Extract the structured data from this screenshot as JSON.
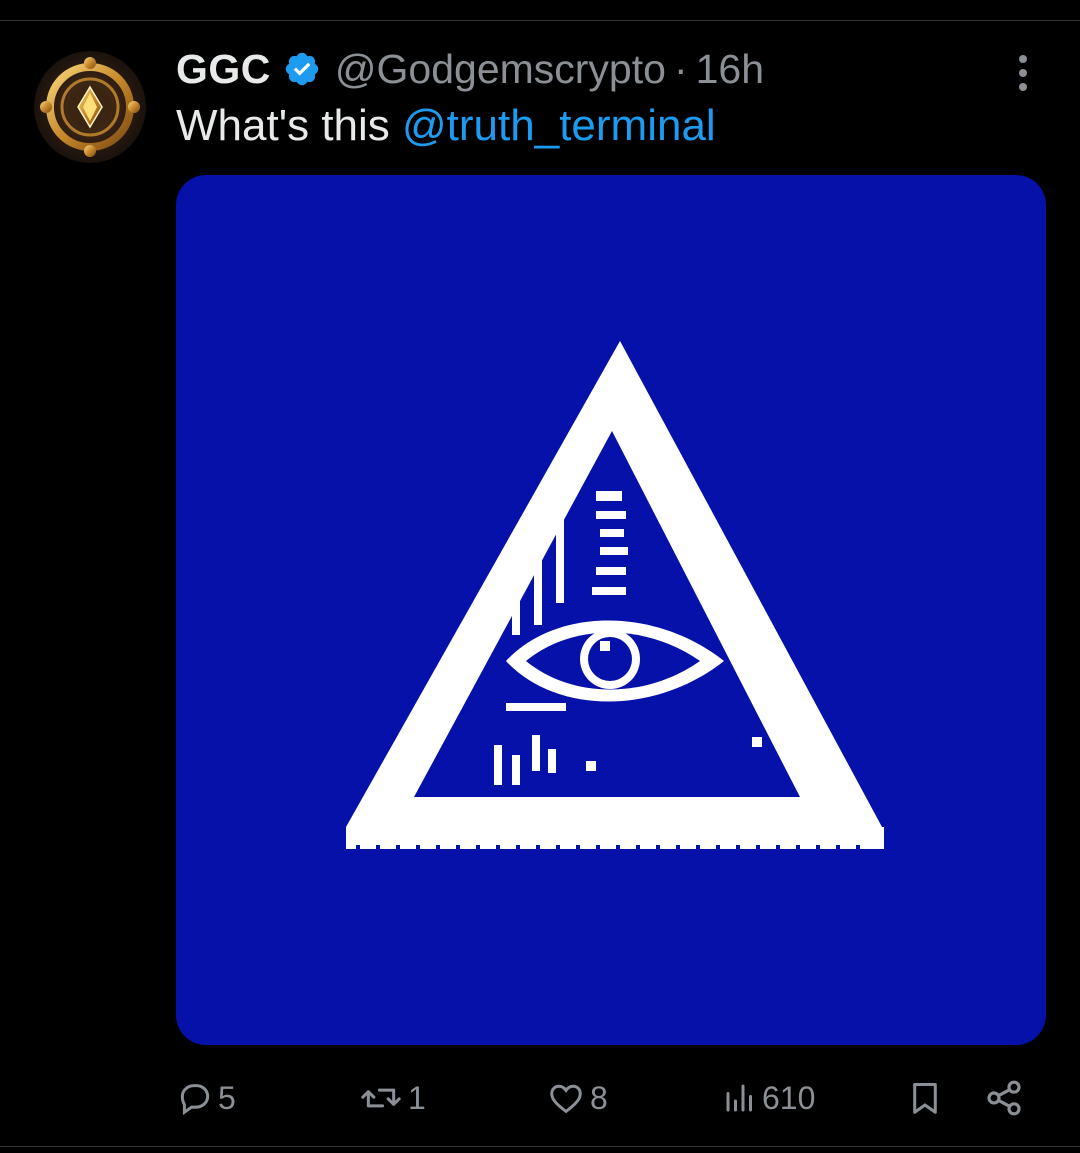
{
  "tweet": {
    "display_name": "GGC",
    "handle": "@Godgemscrypto",
    "separator": "·",
    "time": "16h",
    "text_prefix": "What's this ",
    "mention": "@truth_terminal"
  },
  "metrics": {
    "replies": "5",
    "retweets": "1",
    "likes": "8",
    "views": "610"
  },
  "colors": {
    "background": "#000000",
    "text": "#e7e9ea",
    "muted": "#8b9096",
    "link": "#1d9bf0",
    "verified": "#1d9bf0",
    "media_background": "#0511a8",
    "media_symbol": "#ffffff"
  },
  "icons": {
    "verified": "verified-badge-icon",
    "more": "more-vertical-icon",
    "reply": "reply-bubble-icon",
    "retweet": "retweet-icon",
    "like": "heart-icon",
    "views": "bar-chart-icon",
    "bookmark": "bookmark-icon",
    "share": "share-icon"
  }
}
